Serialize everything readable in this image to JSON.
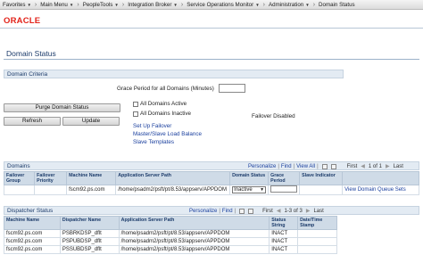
{
  "nav": {
    "items": [
      {
        "label": "Favorites"
      },
      {
        "label": "Main Menu"
      },
      {
        "label": "PeopleTools"
      },
      {
        "label": "Integration Broker"
      },
      {
        "label": "Service Operations Monitor"
      },
      {
        "label": "Administration"
      },
      {
        "label": "Domain Status"
      }
    ],
    "separator": "›"
  },
  "brand": {
    "logo": "ORACLE",
    "logo_color": "#e2231a"
  },
  "page": {
    "title": "Domain Status"
  },
  "criteria": {
    "section_title": "Domain Criteria",
    "grace_label": "Grace Period for all Domains (Minutes)",
    "grace_value": "",
    "purge_button": "Purge Domain Status",
    "refresh_button": "Refresh",
    "update_button": "Update",
    "all_active_label": "All Domains Active",
    "all_inactive_label": "All Domains Inactive",
    "failover_status": "Failover Disabled",
    "links": [
      "Set Up Failover",
      "Master/Slave Load Balance",
      "Slave Templates"
    ]
  },
  "domains_grid": {
    "title": "Domains",
    "personalize": "Personalize",
    "find": "Find",
    "view_all": "View All",
    "pager_first": "First",
    "pager_range": "1 of 1",
    "pager_last": "Last",
    "columns": [
      "Failover Group",
      "Failover Priority",
      "Machine Name",
      "Application Server Path",
      "Domain Status",
      "Grace Period",
      "Slave Indicator",
      ""
    ],
    "rows": [
      {
        "group": "",
        "priority": "",
        "machine": "fscm92.ps.com",
        "path": "/home/psadm2/psft/pt/8.53/appserv/APPDOM",
        "status": "Inactive",
        "grace": "",
        "slave": "",
        "link": "View Domain Queue Sets"
      }
    ]
  },
  "dispatcher_grid": {
    "title": "Dispatcher Status",
    "personalize": "Personalize",
    "find": "Find",
    "pager_first": "First",
    "pager_range": "1-3 of 3",
    "pager_last": "Last",
    "columns": [
      "Machine Name",
      "Dispatcher Name",
      "Application Server Path",
      "Status String",
      "Date/Time Stamp"
    ],
    "rows": [
      {
        "machine": "fscm92.ps.com",
        "name": "PSBRKDSP_dflt",
        "path": "/home/psadm2/psft/pt/8.53/appserv/APPDOM",
        "status": "INACT",
        "stamp": ""
      },
      {
        "machine": "fscm92.ps.com",
        "name": "PSPUBDSP_dflt",
        "path": "/home/psadm2/psft/pt/8.53/appserv/APPDOM",
        "status": "INACT",
        "stamp": ""
      },
      {
        "machine": "fscm92.ps.com",
        "name": "PSSUBDSP_dflt",
        "path": "/home/psadm2/psft/pt/8.53/appserv/APPDOM",
        "status": "INACT",
        "stamp": ""
      }
    ]
  }
}
